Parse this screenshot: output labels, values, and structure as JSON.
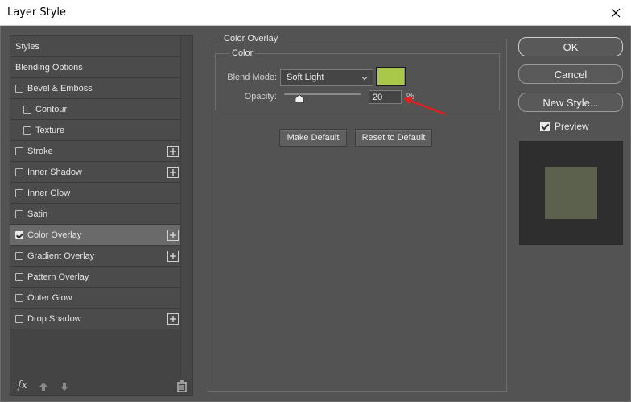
{
  "window": {
    "title": "Layer Style"
  },
  "styles_list": {
    "items": [
      {
        "label": "Styles",
        "type": "header"
      },
      {
        "label": "Blending Options",
        "type": "header"
      },
      {
        "label": "Bevel & Emboss",
        "type": "check",
        "checked": false,
        "indent": false,
        "plus": false
      },
      {
        "label": "Contour",
        "type": "check",
        "checked": false,
        "indent": true,
        "plus": false
      },
      {
        "label": "Texture",
        "type": "check",
        "checked": false,
        "indent": true,
        "plus": false
      },
      {
        "label": "Stroke",
        "type": "check",
        "checked": false,
        "indent": false,
        "plus": true
      },
      {
        "label": "Inner Shadow",
        "type": "check",
        "checked": false,
        "indent": false,
        "plus": true
      },
      {
        "label": "Inner Glow",
        "type": "check",
        "checked": false,
        "indent": false,
        "plus": false
      },
      {
        "label": "Satin",
        "type": "check",
        "checked": false,
        "indent": false,
        "plus": false
      },
      {
        "label": "Color Overlay",
        "type": "check",
        "checked": true,
        "indent": false,
        "plus": true,
        "selected": true
      },
      {
        "label": "Gradient Overlay",
        "type": "check",
        "checked": false,
        "indent": false,
        "plus": true
      },
      {
        "label": "Pattern Overlay",
        "type": "check",
        "checked": false,
        "indent": false,
        "plus": false
      },
      {
        "label": "Outer Glow",
        "type": "check",
        "checked": false,
        "indent": false,
        "plus": false
      },
      {
        "label": "Drop Shadow",
        "type": "check",
        "checked": false,
        "indent": false,
        "plus": true
      }
    ],
    "footer": {
      "fx_label": "fx"
    }
  },
  "color_overlay": {
    "group_title": "Color Overlay",
    "color_group_title": "Color",
    "blend_mode_label": "Blend Mode:",
    "blend_mode_value": "Soft Light",
    "overlay_color": "#a9c84a",
    "opacity_label": "Opacity:",
    "opacity_value": "20",
    "opacity_fraction": 0.2,
    "opacity_unit": "%",
    "make_default_label": "Make Default",
    "reset_default_label": "Reset to Default"
  },
  "actions": {
    "ok_label": "OK",
    "cancel_label": "Cancel",
    "new_style_label": "New Style...",
    "preview_label": "Preview",
    "preview_checked": true
  },
  "preview": {
    "background": "#2e2e2e",
    "swatch_color": "#5c614e"
  },
  "annotation": {
    "arrow_color": "#e02020"
  }
}
